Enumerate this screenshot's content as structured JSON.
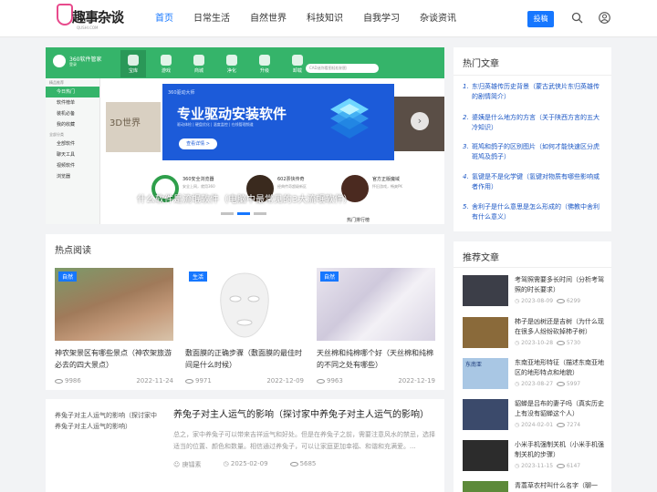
{
  "header": {
    "logo_text": "趣事杂谈",
    "logo_sub": "QUSHI.COM",
    "nav": [
      "首页",
      "日常生活",
      "自然世界",
      "科技知识",
      "自我学习",
      "杂谈资讯"
    ],
    "post_button": "投稿",
    "search_icon": "search-icon",
    "user_icon": "user-icon",
    "accent": "#1677ff"
  },
  "slider": {
    "caption": "什么软件是流氓软件（电脑中最常见的3大流氓软件）",
    "screenshot": {
      "app_title": "360软件管家",
      "app_subtitle": "登录",
      "tabs": [
        "宝库",
        "游戏",
        "商城",
        "净化",
        "升级",
        "卸载"
      ],
      "search_placeholder": "CAD迷你看图轻松制图",
      "side_head_1": "精品推荐",
      "side_items": [
        "今日热门",
        "软件榜单",
        "装机必备",
        "我的收藏"
      ],
      "side_head_2": "全部分类",
      "side_items_2": [
        "全部软件",
        "聊天工具",
        "视频软件",
        "浏览器"
      ],
      "card_left_text": "3D世界",
      "banner_logo": "360驱动大师",
      "banner_title": "专业驱动安装软件",
      "banner_sub": "驱动体检 | 硬盘优化 | 温度监控 | 在线管理频道",
      "banner_button": "查看详情 >",
      "apps": [
        {
          "name": "360安全浏览器",
          "desc": "安全上网，就用360"
        },
        {
          "name": "602票快传奇",
          "desc": "经典传奇超级新区"
        },
        {
          "name": "官方正版魔域",
          "desc": "怀旧游戏，畅爽PK"
        }
      ],
      "bottom_link": "热门排行榜"
    },
    "dots": 3,
    "active_dot": 1
  },
  "hot_read": {
    "title": "热点阅读",
    "cards": [
      {
        "badge": "自然",
        "title": "神农架景区有哪些景点（神农架旅游必去的四大景点）",
        "views": "9986",
        "date": "2022-11-24"
      },
      {
        "badge": "生活",
        "title": "敷面膜的正确步骤（敷面膜的最佳时间是什么时候）",
        "views": "9971",
        "date": "2022-12-09"
      },
      {
        "badge": "自然",
        "title": "天丝棉和纯棉哪个好（天丝棉和纯棉的不同之处有哪些）",
        "views": "9963",
        "date": "2022-12-19"
      }
    ]
  },
  "article": {
    "img_alt": "养兔子对主人运气的影响（探讨家中养兔子对主人运气的影响）",
    "title": "养兔子对主人运气的影响（探讨家中养兔子对主人运气的影响）",
    "desc": "总之，家中养兔子可以带来吉祥运气和好处。但是在养兔子之前，需要注意风水的禁忌，选择适当的位置、颜色和数量。相信通过养兔子，可以让家庭更加幸福、和谐和充满爱。...",
    "author": "庚镭素",
    "date": "2025-02-09",
    "views": "5685"
  },
  "hot_articles": {
    "title": "热门文章",
    "items": [
      "东归英雄传历史背景（蒙古武侠片东归英雄传的剧情简介）",
      "婆姨是什么地方的方言（关于陕西方言的五大冷知识）",
      "斑鸠和鸽子的区别图片（如何才能快速区分虎斑鸠及鸽子）",
      "氢键是不是化学键（氢键对物质有哪些影响或者作用）",
      "舍利子是什么意思是怎么形成的（佛教中舍利有什么意义）"
    ]
  },
  "recommended": {
    "title": "推荐文章",
    "items": [
      {
        "title": "考驾照需要多长时间（分析考驾照的时长要求）",
        "date": "2023-08-09",
        "views": "6299",
        "color": "#3c3e48"
      },
      {
        "title": "柿子是凶树还是吉树（为什么现在很多人纷纷砍掉柿子树）",
        "date": "2023-10-28",
        "views": "5730",
        "color": "#8a6a3a"
      },
      {
        "title": "东南亚地形特征（描述东南亚地区的地形特点和地貌）",
        "date": "2023-08-27",
        "views": "5997",
        "color": "#a9c7e4",
        "thumb_text": "东南亚"
      },
      {
        "title": "貂蝉是吕布的妻子吗（真实历史上有没有貂蝉这个人）",
        "date": "2024-02-01",
        "views": "7274",
        "color": "#3b4a6b"
      },
      {
        "title": "小米手机强制关机（小米手机强制关机的步骤）",
        "date": "2023-11-15",
        "views": "6147",
        "color": "#2c2c2c"
      },
      {
        "title": "青蒿草农村叫什么名字（聊一",
        "date": "",
        "views": "",
        "color": "#5d8a3a"
      }
    ]
  }
}
